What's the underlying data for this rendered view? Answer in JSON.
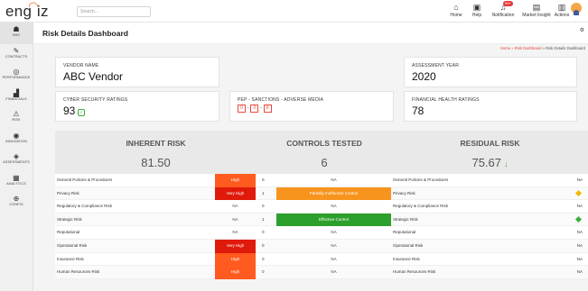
{
  "app": {
    "logo_text": "eng",
    "logo_text2": "iz",
    "search_placeholder": "Search..."
  },
  "topbar": {
    "items": [
      {
        "label": "Home",
        "icon": "home-icon",
        "glyph": "⌂"
      },
      {
        "label": "Help",
        "icon": "help-icon",
        "glyph": "▣"
      },
      {
        "label": "Notification",
        "icon": "bell-icon",
        "glyph": "♫",
        "badge": "99+"
      },
      {
        "label": "Market Insight",
        "icon": "market-insight-icon",
        "glyph": "▤"
      },
      {
        "label": "Actions",
        "icon": "actions-icon",
        "glyph": "▥"
      }
    ]
  },
  "sidebar": {
    "items": [
      {
        "label": "VMC",
        "icon": "vmc-icon",
        "glyph": "☗"
      },
      {
        "label": "CONTRACTS",
        "icon": "contracts-icon",
        "glyph": "✎"
      },
      {
        "label": "PERFORMANCE",
        "icon": "performance-icon",
        "glyph": "◎"
      },
      {
        "label": "FINANCIALS",
        "icon": "financials-icon",
        "glyph": "▟"
      },
      {
        "label": "RISK",
        "icon": "risk-icon",
        "glyph": "⚠"
      },
      {
        "label": "INNOVATION",
        "icon": "innovation-icon",
        "glyph": "◉"
      },
      {
        "label": "ASSESSMENTS",
        "icon": "assessments-icon",
        "glyph": "◈"
      },
      {
        "label": "ANALYTICS",
        "icon": "analytics-icon",
        "glyph": "▦"
      },
      {
        "label": "CONFIG",
        "icon": "config-icon",
        "glyph": "⊕"
      }
    ]
  },
  "page": {
    "title": "Risk Details Dashboard",
    "breadcrumb_home": "Home",
    "breadcrumb_sep": " » ",
    "breadcrumb_mid": "Risk Dashboard",
    "breadcrumb_current": "Risk Details Dashboard"
  },
  "cards": {
    "vendor_label": "VENDOR NAME",
    "vendor_value": "ABC Vendor",
    "year_label": "ASSESSMENT YEAR",
    "year_value": "2020",
    "cyber_label": "CYBER SECURITY RATINGS",
    "cyber_value": "93",
    "pep_label": "PEP - SANCTIONS - ADVERSE MEDIA",
    "pep_values": [
      "0",
      "0",
      "6"
    ],
    "financial_label": "FINANCIAL HEALTH RATINGS",
    "financial_value": "78"
  },
  "summary": {
    "inherent_title": "INHERENT RISK",
    "inherent_value": "81.50",
    "controls_title": "CONTROLS TESTED",
    "controls_value": "6",
    "residual_title": "RESIDUAL RISK",
    "residual_value": "75.67",
    "residual_arrow": "↓"
  },
  "colors": {
    "high": "#ff5a1f",
    "very_high": "#e01a0a",
    "partial": "#f7941d",
    "effective": "#2ca02c",
    "diamond_medium": "#f5b800",
    "diamond_low": "#3cae3c"
  },
  "risk_rows": [
    {
      "name": "General Policies & Procedures",
      "inherent": "High",
      "inherent_level": "high",
      "count": "0",
      "control": "NA",
      "control_level": "NA",
      "residual_name": "General Policies & Procedures",
      "residual": "NA",
      "residual_level": "NA"
    },
    {
      "name": "Privacy Risk",
      "inherent": "Very High",
      "inherent_level": "very_high",
      "count": "1",
      "control": "Partially Ineffective Control",
      "control_level": "partial",
      "residual_name": "Privacy Risk",
      "residual": "",
      "residual_level": "diamond_medium"
    },
    {
      "name": "Regulatory & Compliance Risk",
      "inherent": "NA",
      "inherent_level": "NA",
      "count": "0",
      "control": "NA",
      "control_level": "NA",
      "residual_name": "Regulatory & Compliance Risk",
      "residual": "NA",
      "residual_level": "NA"
    },
    {
      "name": "Strategic Risk",
      "inherent": "NA",
      "inherent_level": "NA",
      "count": "1",
      "control": "Effective Control",
      "control_level": "effective",
      "residual_name": "Strategic Risk",
      "residual": "",
      "residual_level": "diamond_low"
    },
    {
      "name": "Reputational",
      "inherent": "NA",
      "inherent_level": "NA",
      "count": "0",
      "control": "NA",
      "control_level": "NA",
      "residual_name": "Reputational",
      "residual": "NA",
      "residual_level": "NA"
    },
    {
      "name": "Operational Risk",
      "inherent": "Very High",
      "inherent_level": "very_high",
      "count": "0",
      "control": "NA",
      "control_level": "NA",
      "residual_name": "Operational Risk",
      "residual": "NA",
      "residual_level": "NA"
    },
    {
      "name": "Insurance Risk",
      "inherent": "High",
      "inherent_level": "high",
      "count": "0",
      "control": "NA",
      "control_level": "NA",
      "residual_name": "Insurance Risk",
      "residual": "NA",
      "residual_level": "NA"
    },
    {
      "name": "Human Resources Risk",
      "inherent": "High",
      "inherent_level": "high",
      "count": "0",
      "control": "NA",
      "control_level": "NA",
      "residual_name": "Human Resources Risk",
      "residual": "NA",
      "residual_level": "NA"
    }
  ]
}
